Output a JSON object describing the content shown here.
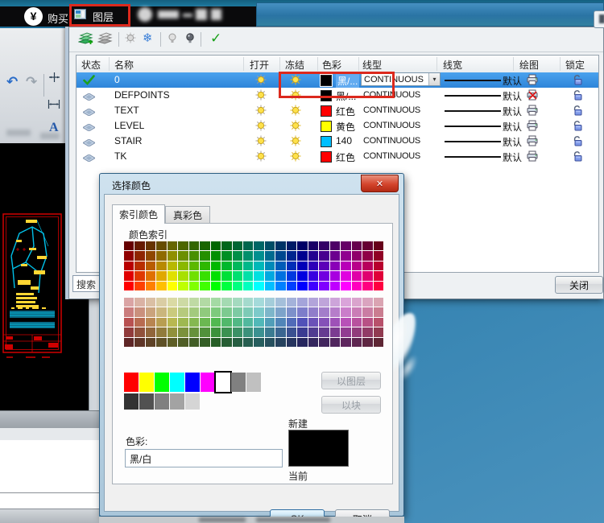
{
  "desktop": {
    "sky_top": "#1d6d97",
    "sky_bottom": "#4a92bd"
  },
  "cad_app": {
    "promo_symbol": "¥",
    "promo_text": "购买",
    "ribbon_icons": [
      "undo",
      "redo",
      "dim-linear",
      "dim-width",
      "text-style-A"
    ],
    "drawing_colors": {
      "frame": "#d00000",
      "lines": "#00c0e8",
      "labels": "#ffd633"
    }
  },
  "layer_window": {
    "title": "图层",
    "toolbar_icons": [
      "new-layer",
      "delete-layer",
      "thaw-sun",
      "freeze-snowflake",
      "bulb-off",
      "bulb-on",
      "apply-check"
    ],
    "table": {
      "columns": [
        "状态",
        "名称",
        "打开",
        "冻结",
        "色彩",
        "线型",
        "线宽",
        "绘图",
        "锁定"
      ],
      "rows": [
        {
          "name": "0",
          "current": true,
          "selected": true,
          "color_hex": "#000000",
          "color_label": "黑/...",
          "linetype": "CONTINUOUS",
          "linetype_dropdown": true,
          "lineweight": "默认",
          "plot": true
        },
        {
          "name": "DEFPOINTS",
          "current": false,
          "selected": false,
          "color_hex": "#000000",
          "color_label": "黑/...",
          "linetype": "CONTINUOUS",
          "linetype_dropdown": false,
          "lineweight": "默认",
          "plot": false
        },
        {
          "name": "TEXT",
          "current": false,
          "selected": false,
          "color_hex": "#ff0000",
          "color_label": "红色",
          "linetype": "CONTINUOUS",
          "linetype_dropdown": false,
          "lineweight": "默认",
          "plot": true
        },
        {
          "name": "LEVEL",
          "current": false,
          "selected": false,
          "color_hex": "#ffff00",
          "color_label": "黄色",
          "linetype": "CONTINUOUS",
          "linetype_dropdown": false,
          "lineweight": "默认",
          "plot": true
        },
        {
          "name": "STAIR",
          "current": false,
          "selected": false,
          "color_hex": "#00bfff",
          "color_label": "140",
          "linetype": "CONTINUOUS",
          "linetype_dropdown": false,
          "lineweight": "默认",
          "plot": true
        },
        {
          "name": "TK",
          "current": false,
          "selected": false,
          "color_hex": "#ff0000",
          "color_label": "红色",
          "linetype": "CONTINUOUS",
          "linetype_dropdown": false,
          "lineweight": "默认",
          "plot": true
        }
      ]
    },
    "search_text": "搜索",
    "close_button": "关闭",
    "annotation_color": "#dc291d",
    "selection_color": "#2e85d9"
  },
  "color_dialog": {
    "title": "选择颜色",
    "tabs": [
      {
        "label": "索引颜色",
        "active": true
      },
      {
        "label": "真彩色",
        "active": false
      }
    ],
    "palette_label": "颜色索引",
    "palette": {
      "columns": 24,
      "hue_start": 0,
      "hue_step": 15,
      "banks": [
        {
          "saturation": 100,
          "lightness_rows": [
            20,
            28,
            36,
            44,
            50
          ]
        },
        {
          "saturation": 42,
          "lightness_rows": [
            75,
            64,
            52,
            40,
            26
          ]
        }
      ]
    },
    "standard_colors": [
      "#ff0000",
      "#ffff00",
      "#00ff00",
      "#00ffff",
      "#0000ff",
      "#ff00ff",
      "#ffffff",
      "#808080",
      "#c0c0c0"
    ],
    "selected_standard_index": 6,
    "gray_shades": [
      "#333333",
      "#515151",
      "#808080",
      "#a3a3a3",
      "#d5d5d5"
    ],
    "bylayer_button": "以图层",
    "byblock_button": "以块",
    "color_field_label": "色彩:",
    "color_field_value": "黑/白",
    "new_label": "新建",
    "current_label": "当前",
    "preview_color": "#000000",
    "ok_button": "OK",
    "cancel_button": "取消"
  }
}
